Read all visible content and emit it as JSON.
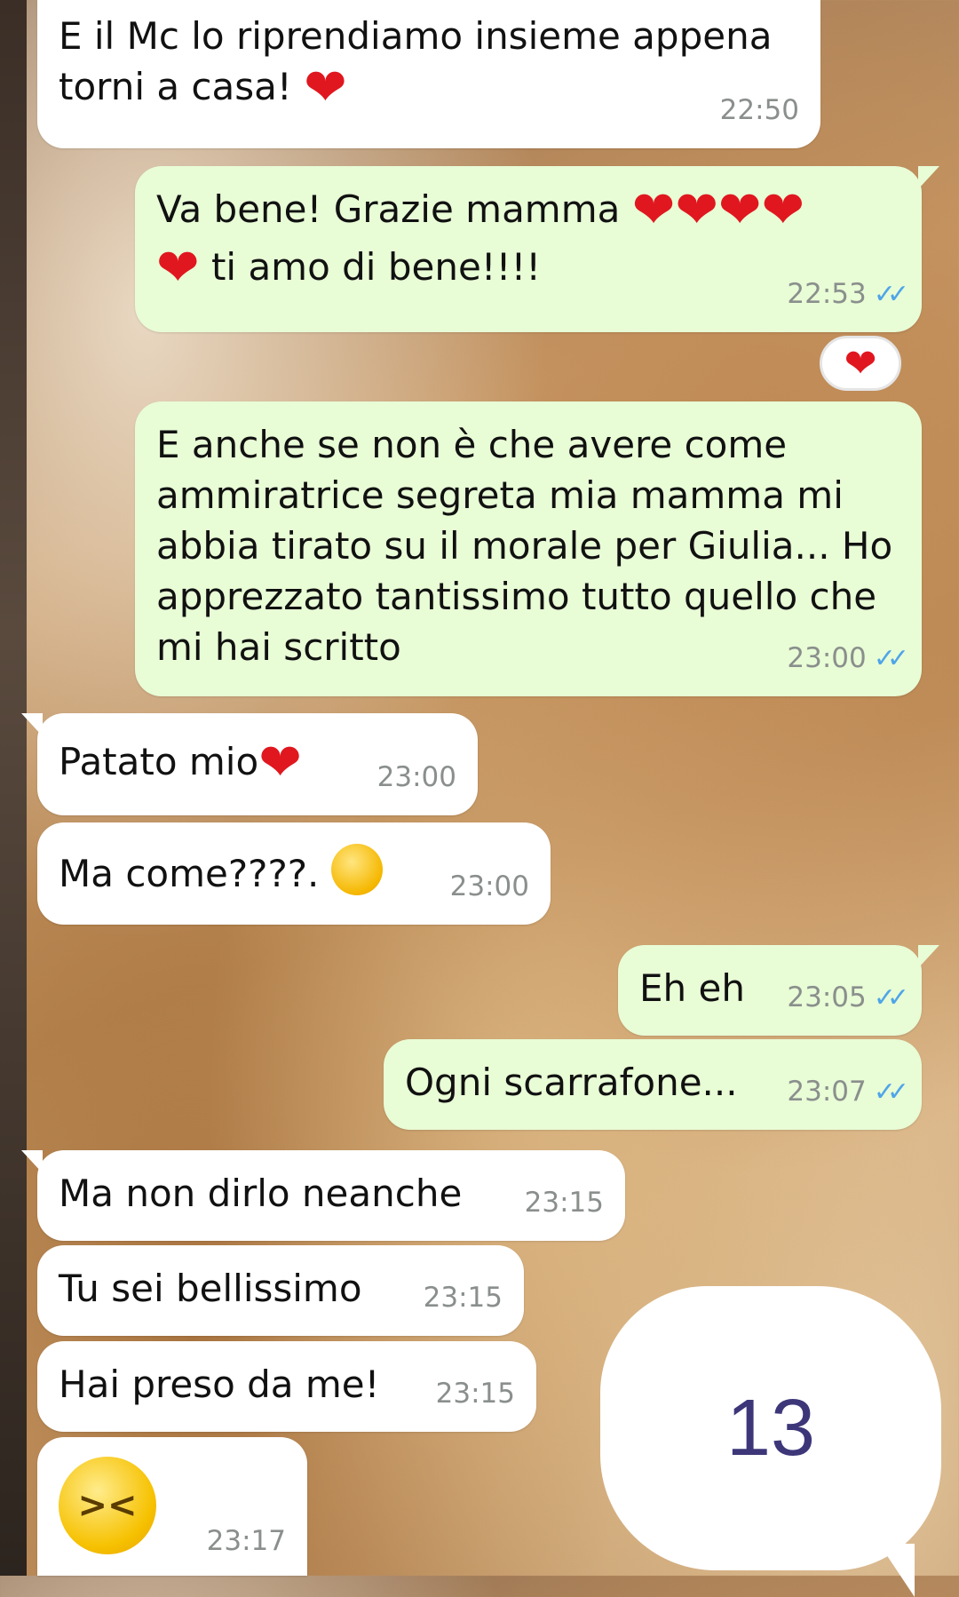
{
  "chat": {
    "messages": [
      {
        "dir": "in",
        "text": "E il Mc lo riprendiamo insieme appena\ntorni a casa! ",
        "emoji": "heart",
        "time": "22:50"
      },
      {
        "dir": "out",
        "text_a": "Va bene! Grazie mamma ",
        "hearts_a": "❤❤❤❤",
        "text_b": " ti amo di bene!!!!",
        "time": "22:53",
        "status": "read"
      },
      {
        "dir": "out",
        "text": "E anche se non è che avere come\nammiratrice segreta mia mamma mi\nabbia tirato su il morale per Giulia... Ho\napprezzato tantissimo tutto quello che\nmi hai scritto",
        "time": "23:00",
        "status": "read"
      },
      {
        "dir": "in",
        "text": "Patato mio",
        "emoji": "heart",
        "time": "23:00"
      },
      {
        "dir": "in",
        "text": "Ma come????. ",
        "emoji": "grinning-sweat-face",
        "time": "23:00"
      },
      {
        "dir": "out",
        "text": "Eh eh",
        "time": "23:05",
        "status": "read"
      },
      {
        "dir": "out",
        "text": "Ogni scarrafone...",
        "time": "23:07",
        "status": "read"
      },
      {
        "dir": "in",
        "text": "Ma non dirlo neanche",
        "time": "23:15"
      },
      {
        "dir": "in",
        "text": "Tu sei bellissimo",
        "time": "23:15"
      },
      {
        "dir": "in",
        "text": "Hai preso da me!",
        "time": "23:15"
      },
      {
        "dir": "in",
        "emoji": "squinting-laughing-face",
        "time": "23:17"
      }
    ],
    "reaction": {
      "emoji": "heart",
      "symbol": "❤"
    },
    "ticks_symbol": "✓✓",
    "heart_symbol": "❤",
    "counter_label": "13"
  }
}
